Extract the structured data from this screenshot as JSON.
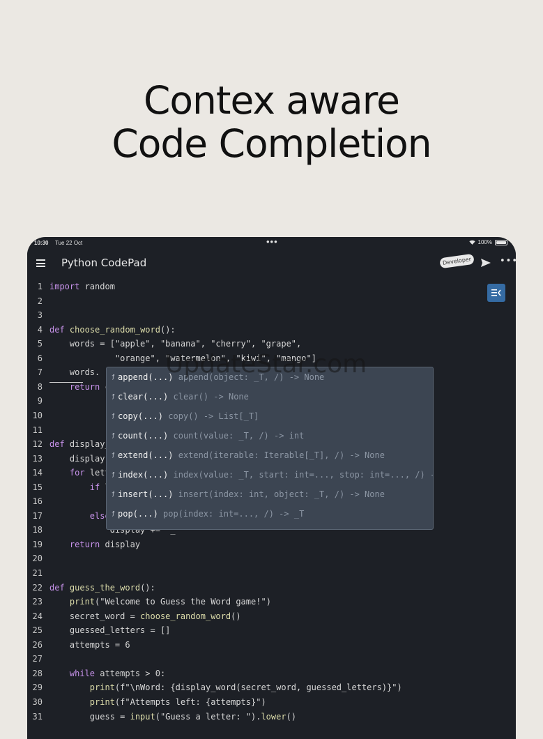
{
  "headline": {
    "line1": "Contex aware",
    "line2": "Code Completion"
  },
  "status_bar": {
    "time": "10:30",
    "date": "Tue 22 Oct",
    "battery": "100%"
  },
  "app_bar": {
    "title": "Python CodePad",
    "badge": "Developer"
  },
  "editor": {
    "lines": [
      {
        "n": "1",
        "code": "import random"
      },
      {
        "n": "2",
        "code": ""
      },
      {
        "n": "3",
        "code": ""
      },
      {
        "n": "4",
        "code": "def choose_random_word():"
      },
      {
        "n": "5",
        "code": "    words = [\"apple\", \"banana\", \"cherry\", \"grape\","
      },
      {
        "n": "6",
        "code": "             \"orange\", \"watermelon\", \"kiwi\", \"mango\"]"
      },
      {
        "n": "7",
        "code": "    words."
      },
      {
        "n": "8",
        "code": "    return c"
      },
      {
        "n": "9",
        "code": ""
      },
      {
        "n": "10",
        "code": ""
      },
      {
        "n": "11",
        "code": ""
      },
      {
        "n": "12",
        "code": "def display_"
      },
      {
        "n": "13",
        "code": "    display"
      },
      {
        "n": "14",
        "code": "    for lett"
      },
      {
        "n": "15",
        "code": "        if l"
      },
      {
        "n": "16",
        "code": ""
      },
      {
        "n": "17",
        "code": "        else"
      },
      {
        "n": "18",
        "code": "            display += \"_\""
      },
      {
        "n": "19",
        "code": "    return display"
      },
      {
        "n": "20",
        "code": ""
      },
      {
        "n": "21",
        "code": ""
      },
      {
        "n": "22",
        "code": "def guess_the_word():"
      },
      {
        "n": "23",
        "code": "    print(\"Welcome to Guess the Word game!\")"
      },
      {
        "n": "24",
        "code": "    secret_word = choose_random_word()"
      },
      {
        "n": "25",
        "code": "    guessed_letters = []"
      },
      {
        "n": "26",
        "code": "    attempts = 6"
      },
      {
        "n": "27",
        "code": ""
      },
      {
        "n": "28",
        "code": "    while attempts > 0:"
      },
      {
        "n": "29",
        "code": "        print(f\"\\nWord: {display_word(secret_word, guessed_letters)}\")"
      },
      {
        "n": "30",
        "code": "        print(f\"Attempts left: {attempts}\")"
      },
      {
        "n": "31",
        "code": "        guess = input(\"Guess a letter: \").lower()"
      }
    ]
  },
  "completion": {
    "items": [
      {
        "name": "append(...)",
        "detail": "append(object: _T, /) -> None"
      },
      {
        "name": "clear(...)",
        "detail": "clear() -> None"
      },
      {
        "name": "copy(...)",
        "detail": "copy() -> List[_T]"
      },
      {
        "name": "count(...)",
        "detail": "count(value: _T, /) -> int"
      },
      {
        "name": "extend(...)",
        "detail": "extend(iterable: Iterable[_T], /) -> None"
      },
      {
        "name": "index(...)",
        "detail": "index(value: _T, start: int=..., stop: int=..., /) ->"
      },
      {
        "name": "insert(...)",
        "detail": "insert(index: int, object: _T, /) -> None"
      },
      {
        "name": "pop(...)",
        "detail": "pop(index: int=..., /) -> _T"
      }
    ]
  },
  "watermark": "UpdateStar.com",
  "icons": {
    "menu": "menu-icon",
    "send": "send-icon",
    "more": "more-icon",
    "panel": "panel-toggle-icon",
    "wifi": "wifi-icon",
    "battery": "battery-icon"
  },
  "colors": {
    "background": "#ebe8e3",
    "editor_bg": "#1d2026",
    "keyword": "#c792ea",
    "function": "#dcdcaa",
    "popup_bg": "#3c4552",
    "accent": "#356ba3"
  }
}
